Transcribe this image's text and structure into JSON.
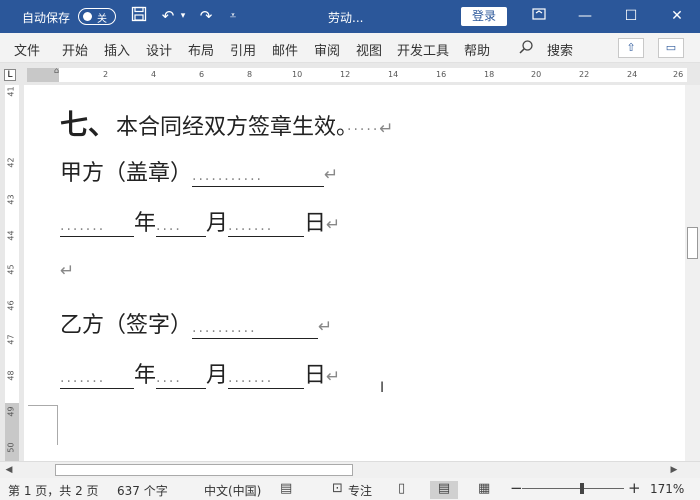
{
  "titlebar": {
    "autosave_label": "自动保存",
    "autosave_state": "关",
    "doc_title": "劳动...",
    "login_label": "登录"
  },
  "menu": {
    "tabs": [
      "文件",
      "开始",
      "插入",
      "设计",
      "布局",
      "引用",
      "邮件",
      "审阅",
      "视图",
      "开发工具",
      "帮助"
    ],
    "search_label": "搜索"
  },
  "ruler": {
    "ticks": [
      "2",
      "4",
      "6",
      "8",
      "10",
      "12",
      "14",
      "16",
      "18",
      "20",
      "22",
      "24",
      "26"
    ],
    "vticks": [
      "41",
      "42",
      "43",
      "44",
      "45",
      "46",
      "47",
      "48",
      "49",
      "50"
    ]
  },
  "document": {
    "line1_num": "七、",
    "line1_text": "本合同经双方签章生效。",
    "line1_dots": "·····",
    "line2_label": "甲方（盖章）",
    "line2_dots": "···········",
    "date_dots1": "·······",
    "date_year": "年",
    "date_dots2": "····",
    "date_month": "月",
    "date_dots3": "·······",
    "date_day": "日",
    "line4_label": "乙方（签字）",
    "line4_dots": "··········",
    "para_mark": "↵"
  },
  "status": {
    "page": "第 1 页，共 2 页",
    "words": "637 个字",
    "language": "中文(中国)",
    "focus": "专注",
    "zoom": "171%"
  }
}
